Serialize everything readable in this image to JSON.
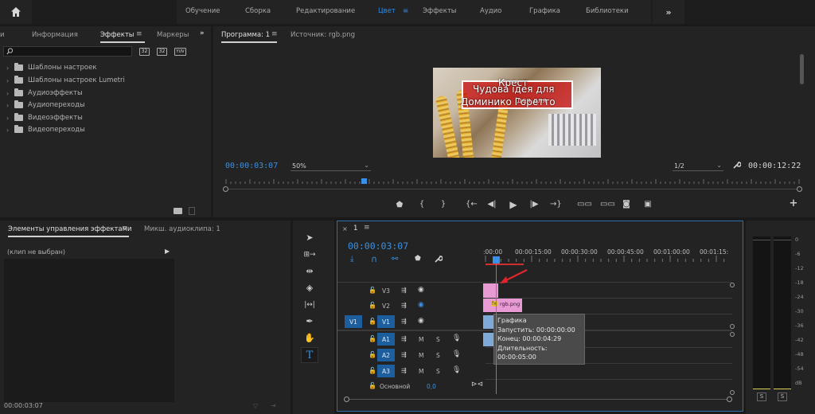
{
  "workspaces": {
    "tabs": [
      "Обучение",
      "Сборка",
      "Редактирование",
      "Цвет",
      "Эффекты",
      "Аудио",
      "Графика",
      "Библиотеки"
    ],
    "active": "Цвет",
    "more": "»"
  },
  "effects_panel": {
    "tab_prev": "и",
    "tab_info": "Информация",
    "tab_effects": "Эффекты",
    "tab_markers": "Маркеры",
    "more": "»",
    "search_value": "",
    "tree": [
      "Шаблоны настроек",
      "Шаблоны настроек Lumetri",
      "Аудиоэффекты",
      "Аудиопереходы",
      "Видеоэффекты",
      "Видеопереходы"
    ],
    "filter_labels": [
      "32",
      "32",
      "YUV"
    ]
  },
  "program_monitor": {
    "tab_program": "Программа: 1",
    "tab_source": "Источник: rgb.png",
    "timecode": "00:00:03:07",
    "zoom": "50%",
    "quality": "1/2",
    "duration": "00:00:12:22",
    "playhead_fraction": 0.24,
    "video_text": {
      "line_top": "Крест",
      "line_a": "Чудова ідея для",
      "line_b": "Доминико Горетто",
      "line_overlap": "ідея для"
    },
    "controls": [
      "marker-icon",
      "in-icon",
      "out-icon",
      "go-in-icon",
      "step-back-icon",
      "play-icon",
      "step-fwd-icon",
      "go-out-icon",
      "lift-icon",
      "extract-icon",
      "camera-icon",
      "compare-icon"
    ],
    "add": "+"
  },
  "effect_controls": {
    "tab_controls": "Элементы управления эффектами",
    "tab_mixer": "Микш. аудиоклипа: 1",
    "clip_state": "(клип не выбран)",
    "timecode": "00:00:03:07"
  },
  "timeline": {
    "sequence": "1",
    "timecode": "00:00:03:07",
    "ruler": [
      ":00:00",
      "00:00:15:00",
      "00:00:30:00",
      "00:00:45:00",
      "00:01:00:00",
      "00:01:15:"
    ],
    "playhead_seconds": 3.3,
    "video_tracks": [
      "V3",
      "V2",
      "V1"
    ],
    "source_patch_video": "V1",
    "audio_tracks": [
      "A1",
      "A2",
      "A3"
    ],
    "audio_m": "M",
    "audio_s": "S",
    "master_label": "Основной",
    "master_value": "0,0",
    "clip_name": "rgb.png",
    "clip_fx": "fx",
    "tooltip": {
      "title": "Графика",
      "start": "Запустить: 00:00:00:00",
      "end": "Конец: 00:00:04:29",
      "duration": "Длительность: 00:00:05:00"
    }
  },
  "audio_meter": {
    "scale": [
      "0",
      "-6",
      "-12",
      "-18",
      "-24",
      "-30",
      "-36",
      "-42",
      "-48",
      "-54",
      "dB"
    ],
    "solo": [
      "S",
      "S"
    ]
  },
  "colors": {
    "accent": "#2d8ceb",
    "graphics_clip": "#e89ad4",
    "timecode_blue": "#3b8fe0",
    "arrow_red": "#e0262a"
  }
}
